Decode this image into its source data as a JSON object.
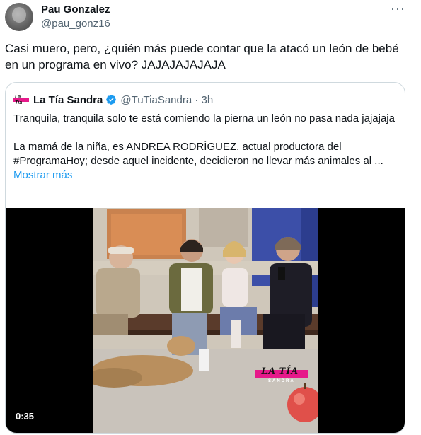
{
  "tweet": {
    "author_name": "Pau Gonzalez",
    "author_handle": "@pau_gonz16",
    "more_label": "···",
    "text": "Casi muero, pero, ¿quién más puede contar que la atacó un león de bebé en un programa en vivo? JAJAJAJAJAJA"
  },
  "quoted": {
    "author_name": "La Tía Sandra",
    "author_handle": "@TuTiaSandra · 3h",
    "logo_text": "La Tía",
    "text_line1": "Tranquila, tranquila solo te está comiendo la pierna un león no pasa nada jajajaja",
    "text_line2": "La mamá de la niña, es ANDREA RODRÍGUEZ, actual productora del #ProgramaHoy; desde aquel incidente, decidieron no llevar más animales al ...",
    "show_more": "Mostrar más",
    "verified_icon": "verified-badge-icon",
    "colors": {
      "verified": "#1d9bf0",
      "link": "#1d9bf0",
      "brand_pink": "#e6198a"
    }
  },
  "video": {
    "duration": "0:35",
    "watermark_title": "LA TÍA",
    "watermark_sub": "SANDRA"
  }
}
